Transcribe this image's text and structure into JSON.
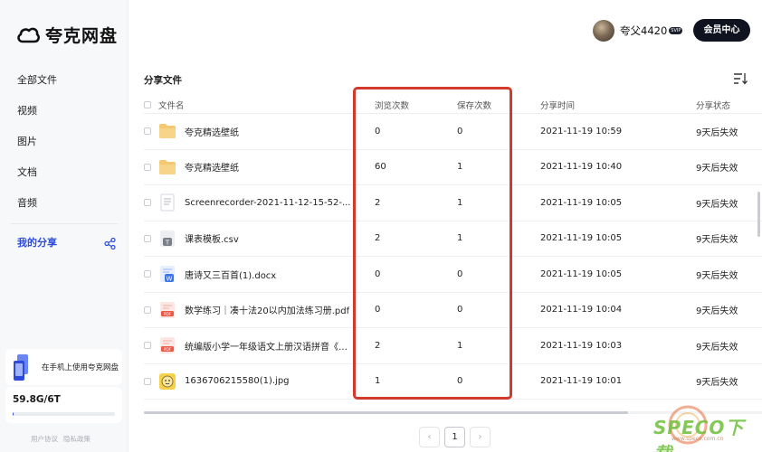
{
  "brand": {
    "name": "夸克网盘"
  },
  "sidebar": {
    "items": [
      {
        "label": "全部文件"
      },
      {
        "label": "视频"
      },
      {
        "label": "图片"
      },
      {
        "label": "文档"
      },
      {
        "label": "音频"
      },
      {
        "label": "我的分享"
      }
    ],
    "promo": "在手机上使用夸克网盘",
    "storage": {
      "text": "59.8G/6T",
      "used_fraction": 0.01
    },
    "footer": {
      "terms": "用户协议",
      "privacy": "隐私政策"
    }
  },
  "header": {
    "username": "夸父4420",
    "badge": "SVIP",
    "member_button": "会员中心"
  },
  "main": {
    "section_title": "分享文件",
    "columns": {
      "name": "文件名",
      "views": "浏览次数",
      "saves": "保存次数",
      "time": "分享时间",
      "status": "分享状态"
    },
    "rows": [
      {
        "icon": "folder-icon",
        "name": "夸克精选壁纸",
        "views": "0",
        "saves": "0",
        "time": "2021-11-19 10:59",
        "status": "9天后失效"
      },
      {
        "icon": "folder-icon",
        "name": "夸克精选壁纸",
        "views": "60",
        "saves": "1",
        "time": "2021-11-19 10:40",
        "status": "9天后失效"
      },
      {
        "icon": "text-file-icon",
        "name": "Screenrecorder-2021-11-12-15-52-...",
        "views": "2",
        "saves": "1",
        "time": "2021-11-19 10:05",
        "status": "9天后失效"
      },
      {
        "icon": "csv-file-icon",
        "name": "课表模板.csv",
        "views": "2",
        "saves": "1",
        "time": "2021-11-19 10:05",
        "status": "9天后失效"
      },
      {
        "icon": "word-file-icon",
        "name": "唐诗又三百首(1).docx",
        "views": "0",
        "saves": "0",
        "time": "2021-11-19 10:05",
        "status": "9天后失效"
      },
      {
        "icon": "pdf-file-icon",
        "name": "数学练习｜凑十法20以内加法练习册.pdf",
        "views": "0",
        "saves": "0",
        "time": "2021-11-19 10:04",
        "status": "9天后失效"
      },
      {
        "icon": "pdf-file-icon",
        "name": "统编版小学一年级语文上册汉语拼音《d...",
        "views": "2",
        "saves": "1",
        "time": "2021-11-19 10:03",
        "status": "9天后失效"
      },
      {
        "icon": "image-file-icon",
        "name": "1636706215580(1).jpg",
        "views": "1",
        "saves": "0",
        "time": "2021-11-19 10:01",
        "status": "9天后失效"
      }
    ]
  },
  "pagination": {
    "prev": "‹",
    "current": "1",
    "next": "›"
  },
  "watermark": {
    "text": "SPECO下载",
    "sub": "www.speco.com.cn"
  },
  "colors": {
    "accent": "#2d4bd8",
    "highlight": "#d23a2c"
  }
}
